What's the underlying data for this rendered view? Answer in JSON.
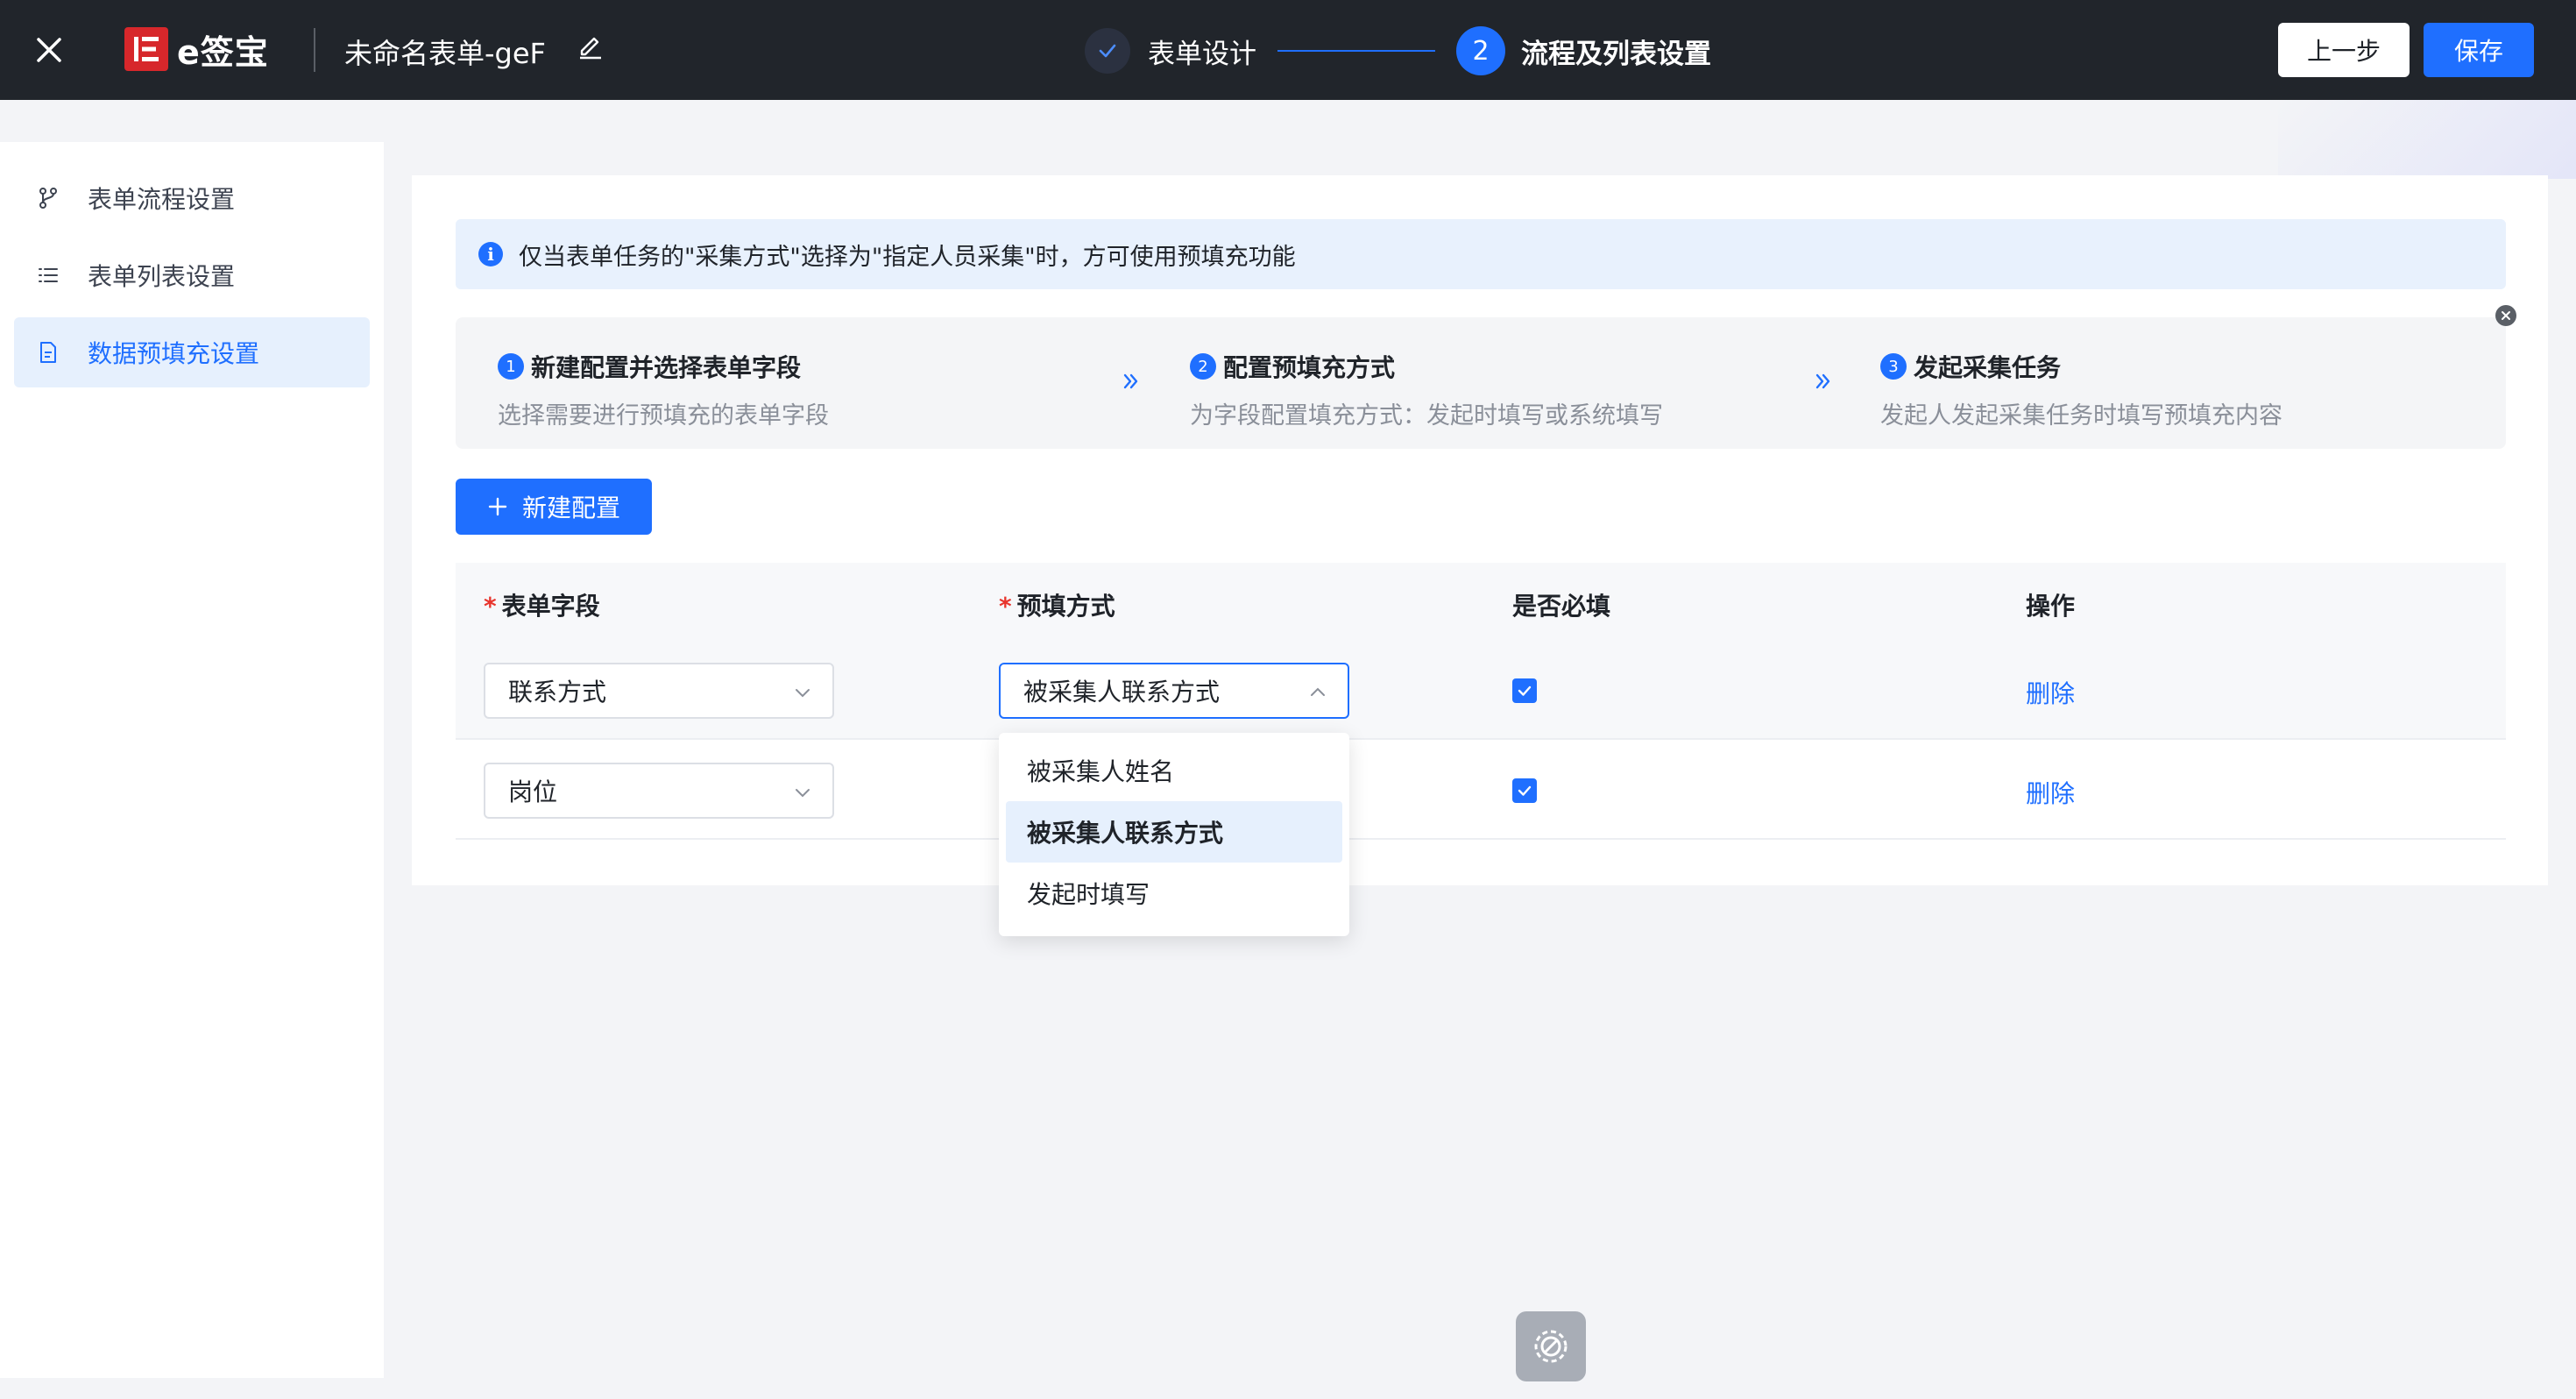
{
  "header": {
    "logo_text": "e签宝",
    "form_title": "未命名表单-geF",
    "steps": [
      {
        "label": "表单设计",
        "status": "done"
      },
      {
        "label": "流程及列表设置",
        "number": "2",
        "status": "active"
      }
    ],
    "prev_label": "上一步",
    "save_label": "保存"
  },
  "sidebar": {
    "items": [
      {
        "label": "表单流程设置",
        "icon": "branch-icon"
      },
      {
        "label": "表单列表设置",
        "icon": "list-icon"
      },
      {
        "label": "数据预填充设置",
        "icon": "document-icon",
        "active": true
      }
    ]
  },
  "main": {
    "info_text": "仅当表单任务的\"采集方式\"选择为\"指定人员采集\"时，方可使用预填充功能",
    "guide": [
      {
        "num": "1",
        "title": "新建配置并选择表单字段",
        "desc": "选择需要进行预填充的表单字段"
      },
      {
        "num": "2",
        "title": "配置预填充方式",
        "desc": "为字段配置填充方式：发起时填写或系统填写"
      },
      {
        "num": "3",
        "title": "发起采集任务",
        "desc": "发起人发起采集任务时填写预填充内容"
      }
    ],
    "new_config_label": "新建配置",
    "table": {
      "columns": [
        "表单字段",
        "预填方式",
        "是否必填",
        "操作"
      ],
      "required_mark": "*",
      "rows": [
        {
          "field": "联系方式",
          "method": "被采集人联系方式",
          "required": true,
          "action": "删除"
        },
        {
          "field": "岗位",
          "method": "",
          "required": true,
          "action": "删除"
        }
      ]
    },
    "dropdown_options": [
      "被采集人姓名",
      "被采集人联系方式",
      "发起时填写"
    ],
    "dropdown_selected": "被采集人联系方式"
  },
  "colors": {
    "accent": "#1f6fff",
    "topbar": "#21252b",
    "brand": "#d7272b"
  }
}
